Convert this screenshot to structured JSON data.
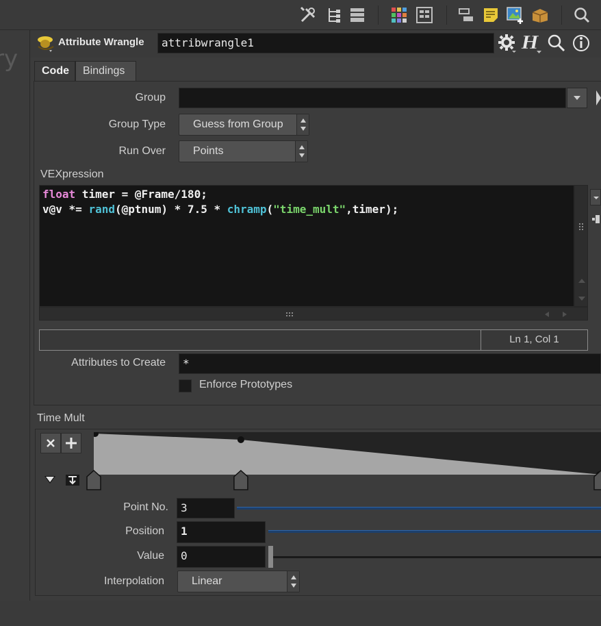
{
  "node": {
    "type_label": "Attribute Wrangle",
    "name": "attribwrangle1"
  },
  "gutter_text": "ry",
  "tabs": [
    {
      "label": "Code"
    },
    {
      "label": "Bindings"
    }
  ],
  "params": {
    "group_label": "Group",
    "group_value": "",
    "group_type_label": "Group Type",
    "group_type_value": "Guess from Group",
    "run_over_label": "Run Over",
    "run_over_value": "Points",
    "vexpression_label": "VEXpression",
    "code_lines": [
      {
        "k": "float",
        "t1": " timer = @Frame/180;"
      },
      {
        "t0": "v@v *= ",
        "f1": "rand",
        "t1": "(@ptnum) * 7.5 * ",
        "f2": "chramp",
        "t2": "(",
        "s": "\"time_mult\"",
        "t3": ",timer);"
      }
    ],
    "status_position": "Ln 1, Col 1",
    "attributes_to_create_label": "Attributes to Create",
    "attributes_to_create_value": "*",
    "enforce_prototypes_label": "Enforce Prototypes",
    "enforce_prototypes_checked": false
  },
  "ramp": {
    "title": "Time Mult",
    "points": [
      {
        "position": 0,
        "value": 1
      },
      {
        "position": 0.29,
        "value": 0.85
      },
      {
        "position": 1,
        "value": 0
      }
    ],
    "point_no_label": "Point No.",
    "point_no_value": "3",
    "position_label": "Position",
    "position_value": "1",
    "value_label": "Value",
    "value_value": "0",
    "interpolation_label": "Interpolation",
    "interpolation_value": "Linear"
  },
  "icons": [
    "tools-icon",
    "tree-icon",
    "list-icon",
    "grid-color-icon",
    "layout-icon",
    "node-icon",
    "note-icon",
    "image-add-icon",
    "package-icon",
    "search-icon",
    "gear-icon",
    "help-h-icon",
    "info-icon"
  ],
  "colors": {
    "keyword": "#e88ad9",
    "function": "#4fc1d6",
    "string": "#7bd66c",
    "slider": "#2f65a8"
  }
}
